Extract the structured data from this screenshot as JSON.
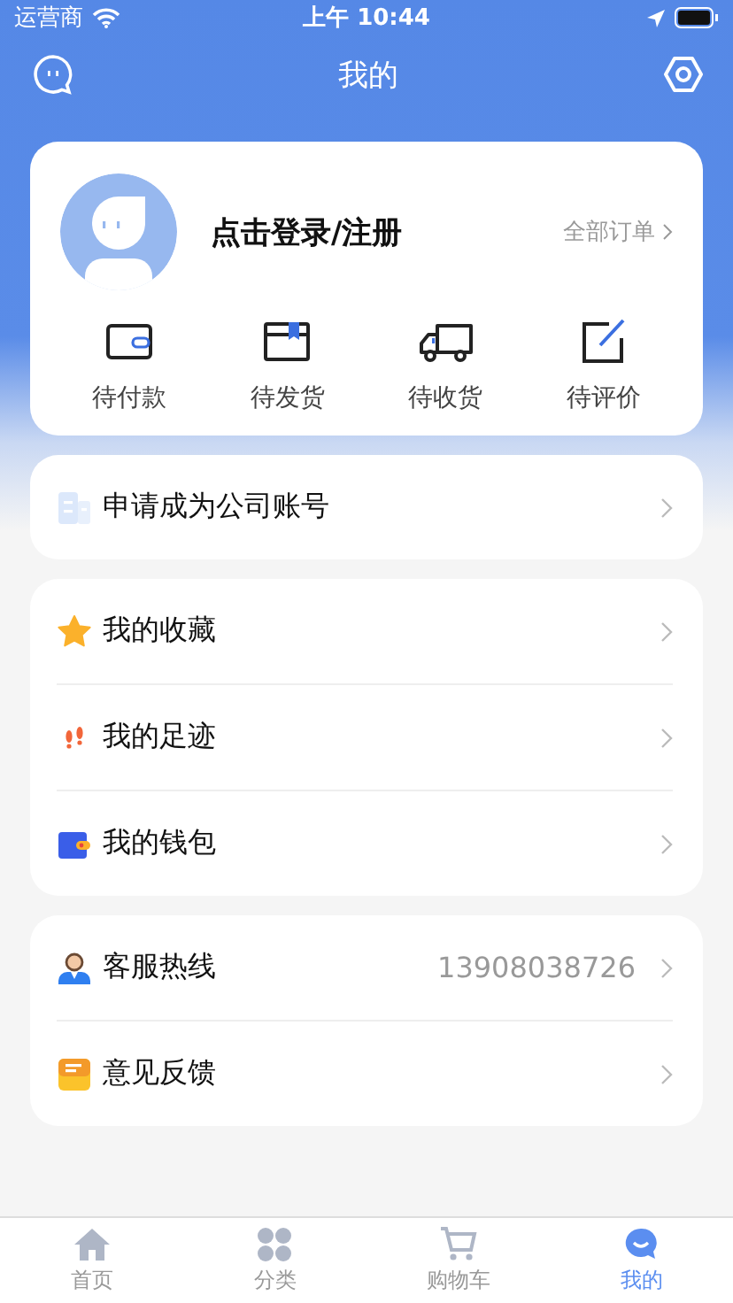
{
  "status_bar": {
    "carrier": "运营商",
    "time": "上午 10:44"
  },
  "header": {
    "title": "我的"
  },
  "profile": {
    "login_text": "点击登录/注册",
    "all_orders": "全部订单"
  },
  "order_statuses": [
    {
      "label": "待付款",
      "kind": "wallet"
    },
    {
      "label": "待发货",
      "kind": "box"
    },
    {
      "label": "待收货",
      "kind": "truck"
    },
    {
      "label": "待评价",
      "kind": "edit"
    }
  ],
  "menu_groups": [
    [
      {
        "label": "申请成为公司账号",
        "kind": "building"
      }
    ],
    [
      {
        "label": "我的收藏",
        "kind": "star"
      },
      {
        "label": "我的足迹",
        "kind": "footprints"
      },
      {
        "label": "我的钱包",
        "kind": "purse"
      }
    ],
    [
      {
        "label": "客服热线",
        "kind": "agent",
        "value": "13908038726"
      },
      {
        "label": "意见反馈",
        "kind": "mail"
      }
    ]
  ],
  "tab_bar": [
    {
      "label": "首页",
      "kind": "home",
      "selected": false
    },
    {
      "label": "分类",
      "kind": "grid",
      "selected": false
    },
    {
      "label": "购物车",
      "kind": "cart",
      "selected": false
    },
    {
      "label": "我的",
      "kind": "chat",
      "selected": true
    }
  ]
}
